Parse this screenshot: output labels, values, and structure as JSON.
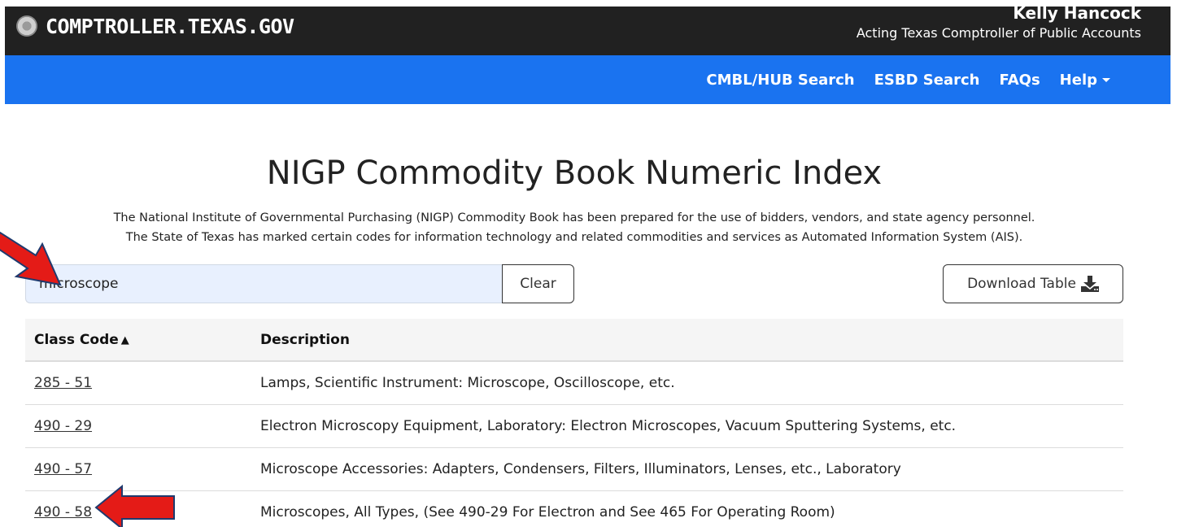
{
  "header": {
    "brand": "COMPTROLLER.TEXAS.GOV",
    "official_name": "Kelly Hancock",
    "official_title": "Acting Texas Comptroller of Public Accounts"
  },
  "nav": {
    "items": [
      {
        "label": "CMBL/HUB Search"
      },
      {
        "label": "ESBD Search"
      },
      {
        "label": "FAQs"
      },
      {
        "label": "Help"
      }
    ]
  },
  "main": {
    "title": "NIGP Commodity Book Numeric Index",
    "intro_line1": "The National Institute of Governmental Purchasing (NIGP) Commodity Book has been prepared for the use of bidders, vendors, and state agency personnel.",
    "intro_line2": "The State of Texas has marked certain codes for information technology and related commodities and services as Automated Information System (AIS).",
    "search_value": "microscope",
    "clear_label": "Clear",
    "download_label": "Download Table"
  },
  "table": {
    "headers": {
      "code": "Class Code",
      "description": "Description"
    },
    "rows": [
      {
        "code": "285 - 51",
        "description": "Lamps, Scientific Instrument: Microscope, Oscilloscope, etc."
      },
      {
        "code": "490 - 29",
        "description": "Electron Microscopy Equipment, Laboratory: Electron Microscopes, Vacuum Sputtering Systems, etc."
      },
      {
        "code": "490 - 57",
        "description": "Microscope Accessories: Adapters, Condensers, Filters, Illuminators, Lenses, etc., Laboratory"
      },
      {
        "code": "490 - 58",
        "description": "Microscopes, All Types, (See 490-29 For Electron and See 465 For Operating Room)"
      }
    ]
  },
  "colors": {
    "topbar": "#212121",
    "navbar": "#1a73f0",
    "arrow": "#e41b17"
  }
}
